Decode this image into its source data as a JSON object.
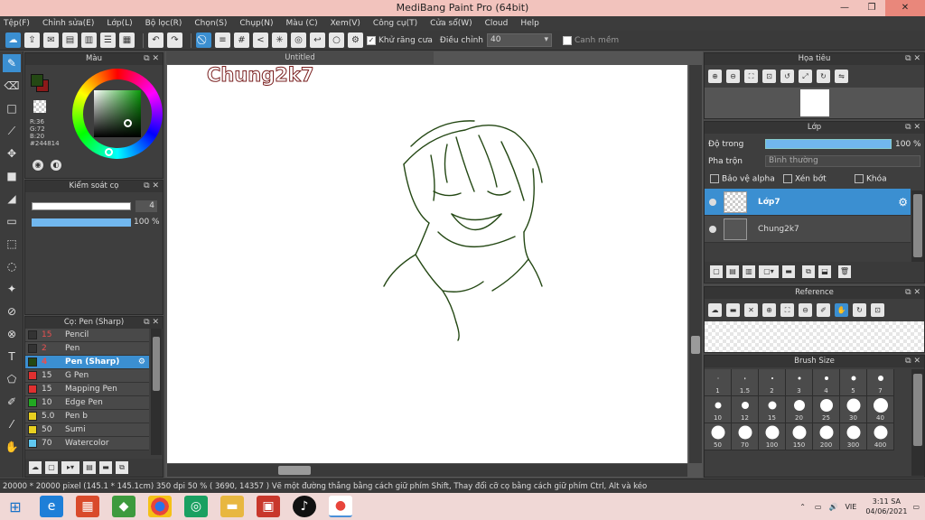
{
  "window": {
    "title": "MediBang Paint Pro (64bit)",
    "controls": [
      "—",
      "❐",
      "✕"
    ]
  },
  "menu": [
    "Tệp(F)",
    "Chỉnh sửa(E)",
    "Lớp(L)",
    "Bộ lọc(R)",
    "Chọn(S)",
    "Chụp(N)",
    "Màu (C)",
    "Xem(V)",
    "Công cụ(T)",
    "Cửa sổ(W)",
    "Cloud",
    "Help"
  ],
  "toolbar": {
    "antialias_label": "Khử răng cưa",
    "correction_label": "Điều chỉnh",
    "correction_value": "40",
    "snap_label": "Canh mềm"
  },
  "color_panel": {
    "title": "Màu",
    "rgb": {
      "r": "R:36",
      "g": "G:72",
      "b": "B:20",
      "hex": "#244814"
    },
    "colors": {
      "foreground": "#244814",
      "background": "#8b1a1a"
    }
  },
  "brush_control": {
    "title": "Kiểm soát cọ",
    "size": "4",
    "opacity": "100 %"
  },
  "brush_list": {
    "title": "Cọ: Pen (Sharp)",
    "items": [
      {
        "size": "15",
        "name": "Pencil",
        "color": "#333333"
      },
      {
        "size": "2",
        "name": "Pen",
        "color": "#333333"
      },
      {
        "size": "4",
        "name": "Pen (Sharp)",
        "color": "#244814"
      },
      {
        "size": "15",
        "name": "G Pen",
        "color": "#e03030"
      },
      {
        "size": "15",
        "name": "Mapping Pen",
        "color": "#e03030"
      },
      {
        "size": "10",
        "name": "Edge Pen",
        "color": "#22aa22"
      },
      {
        "size": "5.0",
        "name": "Pen b",
        "color": "#e8d020"
      },
      {
        "size": "50",
        "name": "Sumi",
        "color": "#e8d020"
      },
      {
        "size": "70",
        "name": "Watercolor",
        "color": "#60c8f0"
      }
    ],
    "selected_index": 2
  },
  "canvas": {
    "tab": "Untitled",
    "signature": "Chung2k7"
  },
  "navigator": {
    "title": "Họa tiêu"
  },
  "layer_panel": {
    "title": "Lớp",
    "opacity_label": "Độ trong",
    "opacity_value": "100 %",
    "blend_label": "Pha trộn",
    "blend_value": "Bình thường",
    "protect_alpha": "Bảo vệ alpha",
    "clipping": "Xén bớt",
    "lock": "Khóa",
    "layers": [
      {
        "name": "Lớp7",
        "selected": true
      },
      {
        "name": "Chung2k7",
        "selected": false
      }
    ]
  },
  "reference": {
    "title": "Reference"
  },
  "brush_size": {
    "title": "Brush Size",
    "sizes": [
      "1",
      "1.5",
      "2",
      "3",
      "4",
      "5",
      "7",
      "10",
      "12",
      "15",
      "20",
      "25",
      "30",
      "40",
      "50",
      "70",
      "100",
      "150",
      "200",
      "300",
      "400"
    ]
  },
  "status": {
    "dimensions": "20000 * 20000 pixel",
    "physical": "(145.1 * 145.1cm)",
    "dpi": "350 dpi",
    "zoom": "50 %",
    "coords": "( 3690, 14357 )",
    "hint": "Vẽ một đường thẳng bằng cách giữ phím Shift, Thay đổi cỡ cọ bằng cách giữ phím Ctrl, Alt và kéo"
  },
  "taskbar": {
    "lang": "VIE",
    "time": "3:11 SA",
    "date": "04/06/2021"
  }
}
